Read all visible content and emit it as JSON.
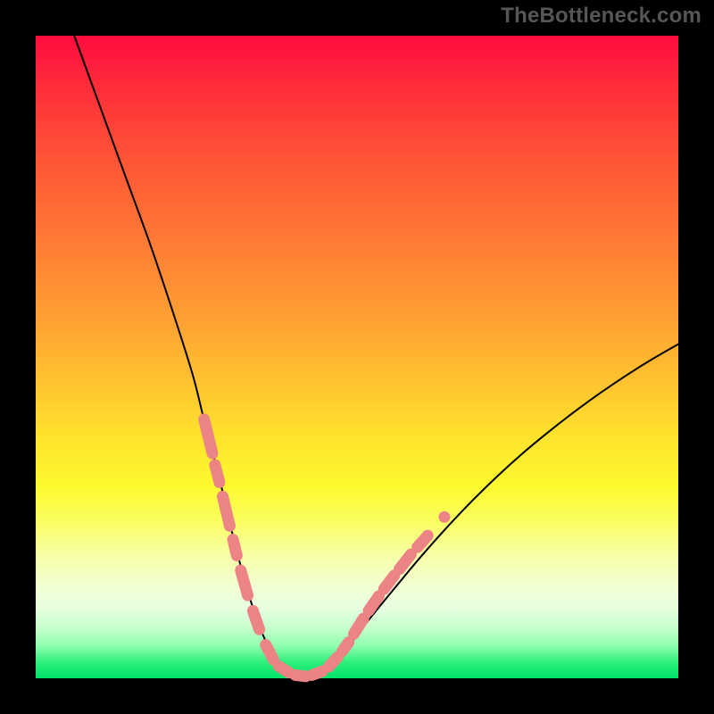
{
  "watermark": "TheBottleneck.com",
  "colors": {
    "background": "#000000",
    "curve_stroke": "#000000",
    "marker_stroke": "#ec8385",
    "gradient_top": "#ff0b3f",
    "gradient_bottom": "#00e26a"
  },
  "chart_data": {
    "type": "line",
    "title": "",
    "xlabel": "",
    "ylabel": "",
    "xlim": [
      0,
      100
    ],
    "ylim": [
      0,
      100
    ],
    "grid": false,
    "series": [
      {
        "name": "bottleneck-curve",
        "x": [
          6,
          10,
          14,
          18,
          22,
          24.5,
          26,
          27,
          28.5,
          30,
          31.5,
          33,
          34.5,
          36,
          37.5,
          39,
          40.5,
          42.5,
          45,
          48,
          52,
          56,
          60,
          64,
          68,
          72,
          76,
          80,
          84,
          88,
          92,
          96,
          100
        ],
        "y": [
          100,
          89,
          78,
          67,
          55,
          47,
          41,
          37,
          31.5,
          25,
          19,
          13.5,
          9,
          5.3,
          2.7,
          1.2,
          0.4,
          0.3,
          1.4,
          4.2,
          9.3,
          14.2,
          19,
          23.5,
          27.7,
          31.6,
          35.2,
          38.5,
          41.6,
          44.5,
          47.2,
          49.7,
          52
        ]
      }
    ],
    "markers": [
      {
        "name": "left-cluster",
        "type": "dashed-pill",
        "segments": [
          {
            "x1": 26.2,
            "y1": 40.3,
            "x2": 27.5,
            "y2": 35.0
          },
          {
            "x1": 27.9,
            "y1": 33.2,
            "x2": 28.6,
            "y2": 30.5
          },
          {
            "x1": 29.1,
            "y1": 28.3,
            "x2": 30.2,
            "y2": 23.7
          },
          {
            "x1": 30.7,
            "y1": 21.6,
            "x2": 31.3,
            "y2": 19.1
          },
          {
            "x1": 31.9,
            "y1": 16.8,
            "x2": 33.0,
            "y2": 12.9
          },
          {
            "x1": 33.8,
            "y1": 10.5,
            "x2": 34.8,
            "y2": 7.6
          }
        ]
      },
      {
        "name": "valley-cluster",
        "type": "dashed-pill",
        "segments": [
          {
            "x1": 35.8,
            "y1": 5.2,
            "x2": 37.0,
            "y2": 2.9
          },
          {
            "x1": 37.8,
            "y1": 1.9,
            "x2": 39.4,
            "y2": 0.9
          },
          {
            "x1": 40.4,
            "y1": 0.5,
            "x2": 42.0,
            "y2": 0.3
          },
          {
            "x1": 43.0,
            "y1": 0.5,
            "x2": 44.6,
            "y2": 1.1
          },
          {
            "x1": 45.6,
            "y1": 1.8,
            "x2": 47.0,
            "y2": 3.3
          },
          {
            "x1": 47.7,
            "y1": 4.2,
            "x2": 48.7,
            "y2": 5.6
          }
        ]
      },
      {
        "name": "right-cluster",
        "type": "dashed-pill",
        "segments": [
          {
            "x1": 49.5,
            "y1": 6.9,
            "x2": 51.0,
            "y2": 9.3
          },
          {
            "x1": 51.8,
            "y1": 10.5,
            "x2": 53.4,
            "y2": 12.8
          },
          {
            "x1": 54.2,
            "y1": 13.9,
            "x2": 55.8,
            "y2": 16.0
          },
          {
            "x1": 56.6,
            "y1": 17.0,
            "x2": 58.4,
            "y2": 19.3
          },
          {
            "x1": 59.4,
            "y1": 20.4,
            "x2": 61.0,
            "y2": 22.2
          }
        ]
      },
      {
        "name": "right-isolated-dot",
        "type": "dot",
        "points": [
          {
            "x": 63.6,
            "y": 25.1
          }
        ]
      }
    ]
  }
}
